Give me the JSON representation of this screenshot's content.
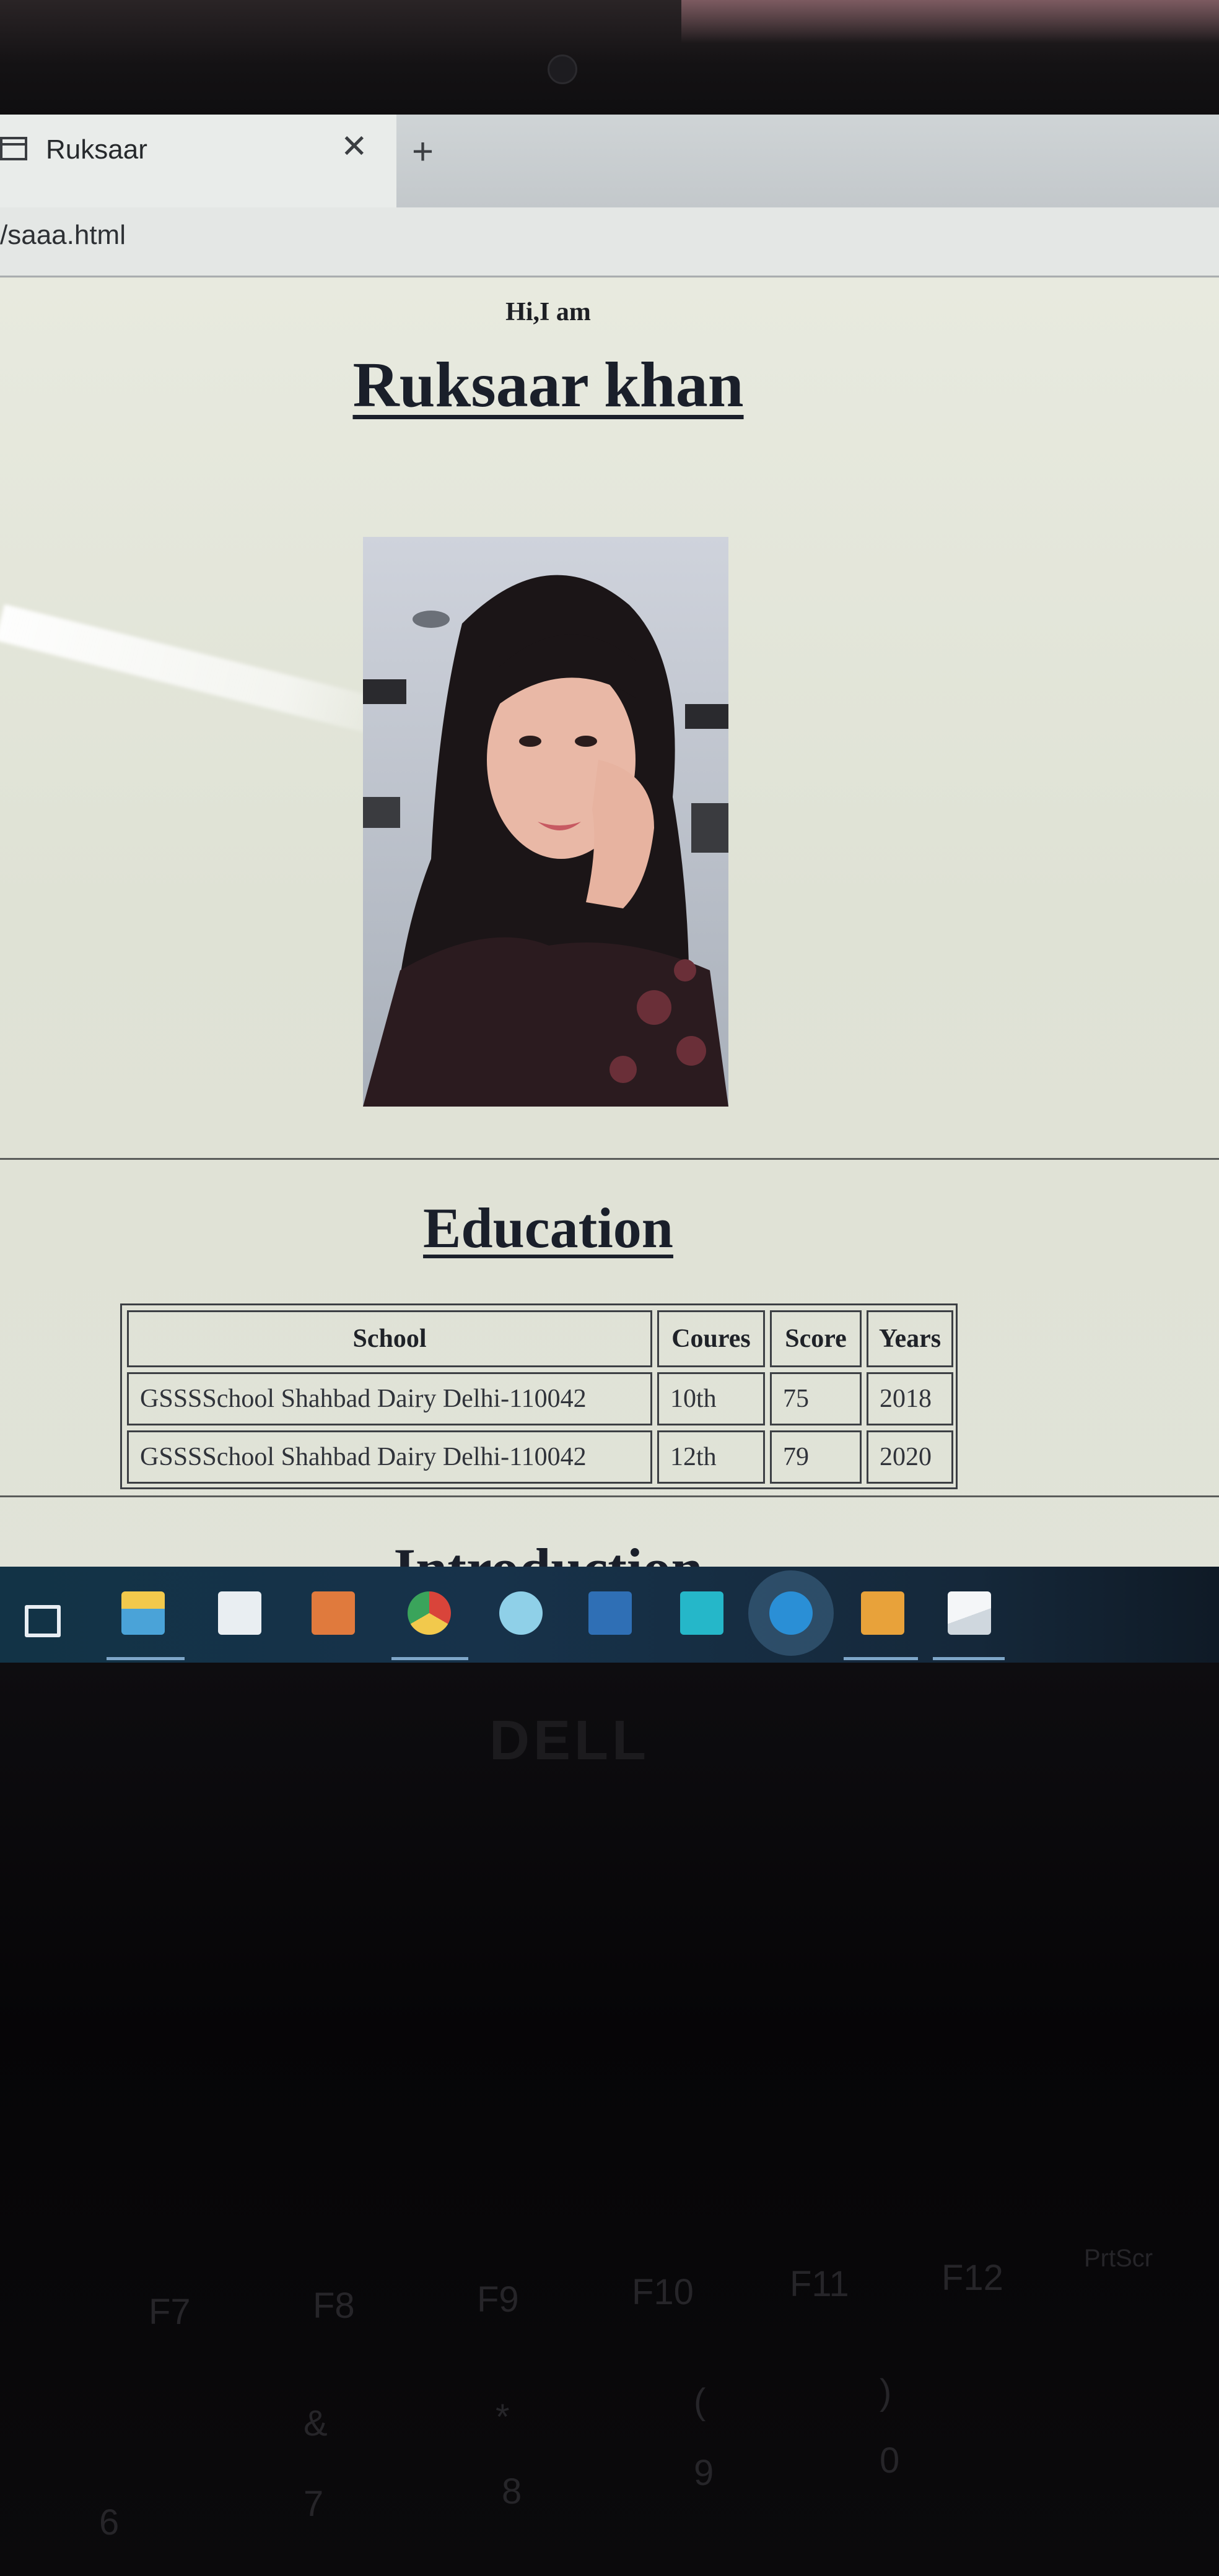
{
  "browser": {
    "tab_title": "Ruksaar",
    "tab_close": "✕",
    "new_tab": "+",
    "address": "/saaa.html"
  },
  "page": {
    "greeting": "Hi,I am",
    "name": "Ruksaar khan",
    "education_heading": "Education",
    "next_heading": "Introduction"
  },
  "education_table": {
    "headers": [
      "School",
      "Coures",
      "Score",
      "Years"
    ],
    "rows": [
      [
        "GSSSSchool Shahbad Dairy Delhi-110042",
        "10th",
        "75",
        "2018"
      ],
      [
        "GSSSSchool Shahbad Dairy Delhi-110042",
        "12th",
        "79",
        "2020"
      ]
    ]
  },
  "taskbar": {
    "icons": [
      "task-view-icon",
      "file-explorer-icon",
      "store-icon",
      "calculator-icon",
      "chrome-icon",
      "safari-icon",
      "word-icon",
      "app-icon",
      "edge-icon",
      "sublime-icon",
      "photos-icon"
    ]
  },
  "laptop": {
    "brand": "DELL",
    "keys": [
      "F7",
      "F8",
      "F9",
      "F10",
      "F11",
      "F12",
      "PrtScr",
      "&",
      "*",
      "(",
      ")",
      "6",
      "7",
      "8",
      "9",
      "0"
    ]
  }
}
